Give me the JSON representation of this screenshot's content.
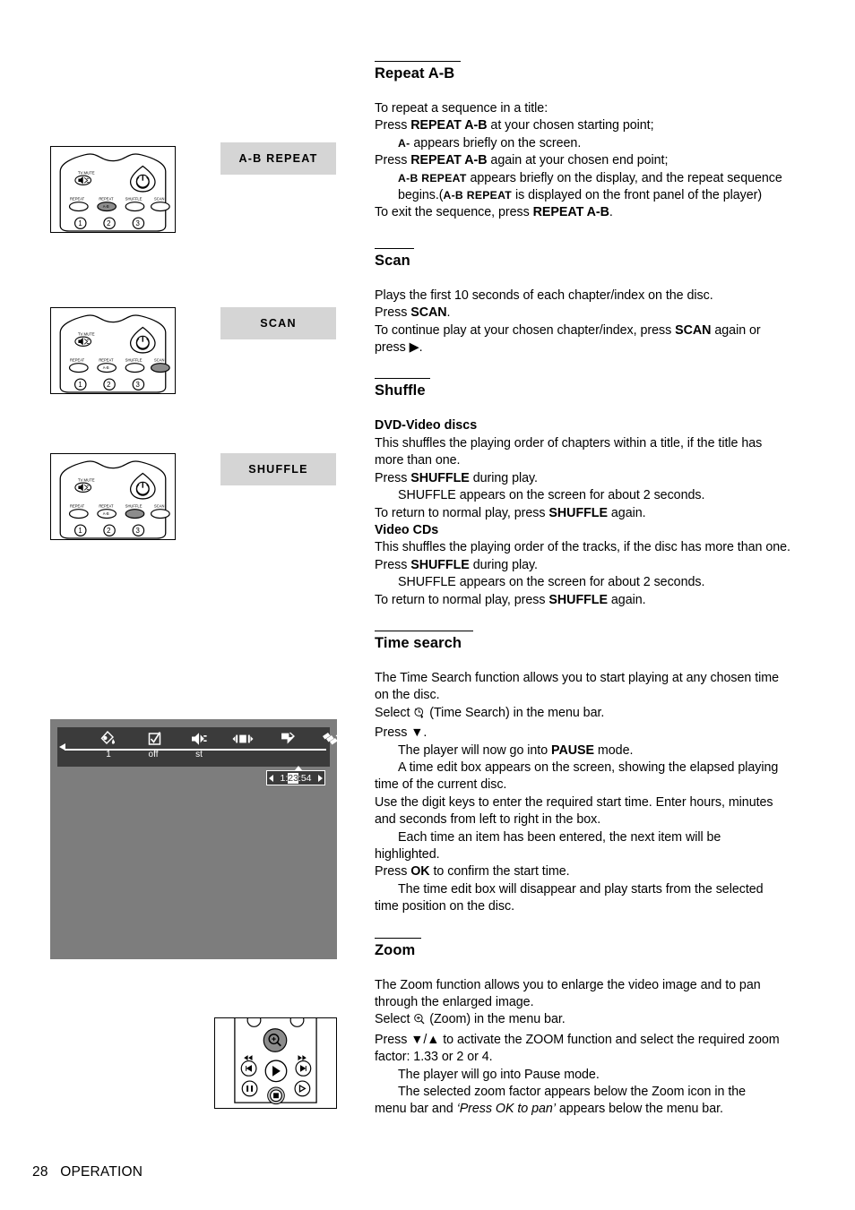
{
  "page": {
    "footer_page_number": "28",
    "footer_section": "OPERATION"
  },
  "figures": {
    "remote_ab_repeat": {
      "label_box": "A-B  REPEAT",
      "tv_mute_label": "TV MUTE",
      "buttons": [
        "REPEAT",
        "REPEAT",
        "SHUFFLE",
        "SCAN"
      ],
      "ab_sub_label": "A-B",
      "callouts": [
        "1",
        "2",
        "3"
      ],
      "highlighted_button": "REPEAT A-B"
    },
    "remote_scan": {
      "label_box": "SCAN",
      "tv_mute_label": "TV MUTE",
      "buttons": [
        "REPEAT",
        "REPEAT",
        "SHUFFLE",
        "SCAN"
      ],
      "ab_sub_label": "A-B",
      "callouts": [
        "1",
        "2",
        "3"
      ],
      "highlighted_button": "SCAN"
    },
    "remote_shuffle": {
      "label_box": "SHUFFLE",
      "tv_mute_label": "TV MUTE",
      "buttons": [
        "REPEAT",
        "REPEAT",
        "SHUFFLE",
        "SCAN"
      ],
      "ab_sub_label": "A-B",
      "callouts": [
        "1",
        "2",
        "3"
      ],
      "highlighted_button": "SHUFFLE"
    },
    "remote_zoom": {
      "highlighted_button": "ZOOM"
    },
    "tv_menu_bar": {
      "icons": [
        "title-chapter-icon",
        "subtitle-icon",
        "audio-language-icon",
        "ab-repeat-icon",
        "shuffle-icon",
        "scan-icon",
        "time-search-icon"
      ],
      "values": [
        "1",
        "off",
        "st"
      ],
      "time_edit_box": {
        "hours": "1",
        "sep1": ":",
        "minutes": "23",
        "sep2": ":",
        "seconds": "54",
        "full": "1:23:54",
        "highlighted_field": "minutes"
      }
    }
  },
  "sections": {
    "repeat_ab": {
      "title": "Repeat A-B",
      "l1": "To repeat a sequence in a title:",
      "l2_a": "Press ",
      "l2_b": "REPEAT A-B",
      "l2_c": " at your chosen starting point;",
      "l3_a": "A-",
      "l3_b": " appears briefly on the screen.",
      "l4_a": "Press ",
      "l4_b": "REPEAT A-B",
      "l4_c": " again at your chosen end point;",
      "l5_a": "A-B REPEAT",
      "l5_b": " appears briefly on the display, and the repeat sequence",
      "l6_a": "begins.(",
      "l6_b": "A-B REPEAT",
      "l6_c": " is displayed on the front panel of the player)",
      "l7_a": "To exit the sequence, press ",
      "l7_b": "REPEAT A-B",
      "l7_c": "."
    },
    "scan": {
      "title": "Scan",
      "l1": "Plays the first 10 seconds of each chapter/index on the disc.",
      "l2_a": "Press ",
      "l2_b": "SCAN",
      "l2_c": ".",
      "l3_a": "To continue play at your chosen chapter/index, press ",
      "l3_b": "SCAN",
      "l3_c": " again or",
      "l4_a": "press ",
      "l4_b": "▶",
      "l4_c": "."
    },
    "shuffle": {
      "title": "Shuffle",
      "sub1": "DVD-Video discs",
      "s1_l1": "This shuffles the playing order of chapters within a title, if the title has",
      "s1_l2": "more than one.",
      "s1_l3_a": "Press ",
      "s1_l3_b": "SHUFFLE",
      "s1_l3_c": " during play.",
      "s1_l4": "SHUFFLE appears on the screen for about 2 seconds.",
      "s1_l5_a": "To return to normal play, press ",
      "s1_l5_b": "SHUFFLE",
      "s1_l5_c": " again.",
      "sub2": "Video CDs",
      "s2_l1": "This shuffles the playing order of the tracks, if the disc has more than one.",
      "s2_l2_a": "Press ",
      "s2_l2_b": "SHUFFLE",
      "s2_l2_c": " during play.",
      "s2_l3": "SHUFFLE appears on the screen for about 2 seconds.",
      "s2_l4_a": "To return to normal play, press ",
      "s2_l4_b": "SHUFFLE",
      "s2_l4_c": " again."
    },
    "time_search": {
      "title": "Time search",
      "l1": "The Time Search function allows you to start playing at any chosen time",
      "l2": "on the disc.",
      "l3_a": "Select ",
      "l3_b": " (Time Search) in the menu bar.",
      "l4": "Press ▼.",
      "l5_a": "The player will now go into ",
      "l5_b": "PAUSE",
      "l5_c": " mode.",
      "l6": "A time edit box appears on the screen, showing the elapsed playing",
      "l7": "time of the current disc.",
      "l8": "Use the digit keys to enter the required start time. Enter hours, minutes",
      "l9": "and seconds from left to right in the box.",
      "l10": "Each time an item has been entered, the next item will be",
      "l11": "highlighted.",
      "l12_a": "Press ",
      "l12_b": "OK",
      "l12_c": "  to confirm the start time.",
      "l13": "The time edit box will disappear and play starts from the selected",
      "l14": "time position on the disc."
    },
    "zoom": {
      "title": "Zoom",
      "l1": "The Zoom function allows you to enlarge the video image and to pan",
      "l2": "through the enlarged image.",
      "l3_a": "Select ",
      "l3_b": " (Zoom) in the menu bar.",
      "l4": "Press ▼/▲ to activate the ZOOM function and select the required zoom",
      "l5": "factor: 1.33 or 2 or 4.",
      "l6": "The player will go into Pause mode.",
      "l7": "The selected zoom factor appears below the Zoom icon in the",
      "l8_a": "menu bar and ",
      "l8_b": "‘Press OK to pan’",
      "l8_c": " appears below the menu bar."
    }
  },
  "colors": {
    "key_box_bg": "#d5d5d5",
    "tv_bg": "#7d7d7d",
    "menu_bar_bg": "#3b3b3b",
    "highlight_button": "#8c8c8c",
    "text": "#000000"
  }
}
